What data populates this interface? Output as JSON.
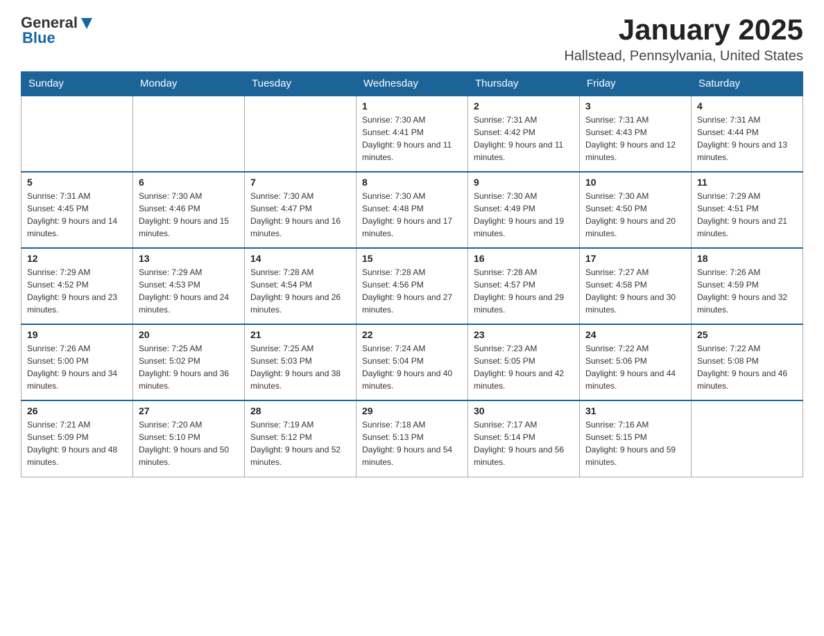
{
  "header": {
    "logo": {
      "general": "General",
      "blue": "Blue"
    },
    "title": "January 2025",
    "location": "Hallstead, Pennsylvania, United States"
  },
  "days_of_week": [
    "Sunday",
    "Monday",
    "Tuesday",
    "Wednesday",
    "Thursday",
    "Friday",
    "Saturday"
  ],
  "weeks": [
    [
      {
        "day": "",
        "sunrise": "",
        "sunset": "",
        "daylight": ""
      },
      {
        "day": "",
        "sunrise": "",
        "sunset": "",
        "daylight": ""
      },
      {
        "day": "",
        "sunrise": "",
        "sunset": "",
        "daylight": ""
      },
      {
        "day": "1",
        "sunrise": "Sunrise: 7:30 AM",
        "sunset": "Sunset: 4:41 PM",
        "daylight": "Daylight: 9 hours and 11 minutes."
      },
      {
        "day": "2",
        "sunrise": "Sunrise: 7:31 AM",
        "sunset": "Sunset: 4:42 PM",
        "daylight": "Daylight: 9 hours and 11 minutes."
      },
      {
        "day": "3",
        "sunrise": "Sunrise: 7:31 AM",
        "sunset": "Sunset: 4:43 PM",
        "daylight": "Daylight: 9 hours and 12 minutes."
      },
      {
        "day": "4",
        "sunrise": "Sunrise: 7:31 AM",
        "sunset": "Sunset: 4:44 PM",
        "daylight": "Daylight: 9 hours and 13 minutes."
      }
    ],
    [
      {
        "day": "5",
        "sunrise": "Sunrise: 7:31 AM",
        "sunset": "Sunset: 4:45 PM",
        "daylight": "Daylight: 9 hours and 14 minutes."
      },
      {
        "day": "6",
        "sunrise": "Sunrise: 7:30 AM",
        "sunset": "Sunset: 4:46 PM",
        "daylight": "Daylight: 9 hours and 15 minutes."
      },
      {
        "day": "7",
        "sunrise": "Sunrise: 7:30 AM",
        "sunset": "Sunset: 4:47 PM",
        "daylight": "Daylight: 9 hours and 16 minutes."
      },
      {
        "day": "8",
        "sunrise": "Sunrise: 7:30 AM",
        "sunset": "Sunset: 4:48 PM",
        "daylight": "Daylight: 9 hours and 17 minutes."
      },
      {
        "day": "9",
        "sunrise": "Sunrise: 7:30 AM",
        "sunset": "Sunset: 4:49 PM",
        "daylight": "Daylight: 9 hours and 19 minutes."
      },
      {
        "day": "10",
        "sunrise": "Sunrise: 7:30 AM",
        "sunset": "Sunset: 4:50 PM",
        "daylight": "Daylight: 9 hours and 20 minutes."
      },
      {
        "day": "11",
        "sunrise": "Sunrise: 7:29 AM",
        "sunset": "Sunset: 4:51 PM",
        "daylight": "Daylight: 9 hours and 21 minutes."
      }
    ],
    [
      {
        "day": "12",
        "sunrise": "Sunrise: 7:29 AM",
        "sunset": "Sunset: 4:52 PM",
        "daylight": "Daylight: 9 hours and 23 minutes."
      },
      {
        "day": "13",
        "sunrise": "Sunrise: 7:29 AM",
        "sunset": "Sunset: 4:53 PM",
        "daylight": "Daylight: 9 hours and 24 minutes."
      },
      {
        "day": "14",
        "sunrise": "Sunrise: 7:28 AM",
        "sunset": "Sunset: 4:54 PM",
        "daylight": "Daylight: 9 hours and 26 minutes."
      },
      {
        "day": "15",
        "sunrise": "Sunrise: 7:28 AM",
        "sunset": "Sunset: 4:56 PM",
        "daylight": "Daylight: 9 hours and 27 minutes."
      },
      {
        "day": "16",
        "sunrise": "Sunrise: 7:28 AM",
        "sunset": "Sunset: 4:57 PM",
        "daylight": "Daylight: 9 hours and 29 minutes."
      },
      {
        "day": "17",
        "sunrise": "Sunrise: 7:27 AM",
        "sunset": "Sunset: 4:58 PM",
        "daylight": "Daylight: 9 hours and 30 minutes."
      },
      {
        "day": "18",
        "sunrise": "Sunrise: 7:26 AM",
        "sunset": "Sunset: 4:59 PM",
        "daylight": "Daylight: 9 hours and 32 minutes."
      }
    ],
    [
      {
        "day": "19",
        "sunrise": "Sunrise: 7:26 AM",
        "sunset": "Sunset: 5:00 PM",
        "daylight": "Daylight: 9 hours and 34 minutes."
      },
      {
        "day": "20",
        "sunrise": "Sunrise: 7:25 AM",
        "sunset": "Sunset: 5:02 PM",
        "daylight": "Daylight: 9 hours and 36 minutes."
      },
      {
        "day": "21",
        "sunrise": "Sunrise: 7:25 AM",
        "sunset": "Sunset: 5:03 PM",
        "daylight": "Daylight: 9 hours and 38 minutes."
      },
      {
        "day": "22",
        "sunrise": "Sunrise: 7:24 AM",
        "sunset": "Sunset: 5:04 PM",
        "daylight": "Daylight: 9 hours and 40 minutes."
      },
      {
        "day": "23",
        "sunrise": "Sunrise: 7:23 AM",
        "sunset": "Sunset: 5:05 PM",
        "daylight": "Daylight: 9 hours and 42 minutes."
      },
      {
        "day": "24",
        "sunrise": "Sunrise: 7:22 AM",
        "sunset": "Sunset: 5:06 PM",
        "daylight": "Daylight: 9 hours and 44 minutes."
      },
      {
        "day": "25",
        "sunrise": "Sunrise: 7:22 AM",
        "sunset": "Sunset: 5:08 PM",
        "daylight": "Daylight: 9 hours and 46 minutes."
      }
    ],
    [
      {
        "day": "26",
        "sunrise": "Sunrise: 7:21 AM",
        "sunset": "Sunset: 5:09 PM",
        "daylight": "Daylight: 9 hours and 48 minutes."
      },
      {
        "day": "27",
        "sunrise": "Sunrise: 7:20 AM",
        "sunset": "Sunset: 5:10 PM",
        "daylight": "Daylight: 9 hours and 50 minutes."
      },
      {
        "day": "28",
        "sunrise": "Sunrise: 7:19 AM",
        "sunset": "Sunset: 5:12 PM",
        "daylight": "Daylight: 9 hours and 52 minutes."
      },
      {
        "day": "29",
        "sunrise": "Sunrise: 7:18 AM",
        "sunset": "Sunset: 5:13 PM",
        "daylight": "Daylight: 9 hours and 54 minutes."
      },
      {
        "day": "30",
        "sunrise": "Sunrise: 7:17 AM",
        "sunset": "Sunset: 5:14 PM",
        "daylight": "Daylight: 9 hours and 56 minutes."
      },
      {
        "day": "31",
        "sunrise": "Sunrise: 7:16 AM",
        "sunset": "Sunset: 5:15 PM",
        "daylight": "Daylight: 9 hours and 59 minutes."
      },
      {
        "day": "",
        "sunrise": "",
        "sunset": "",
        "daylight": ""
      }
    ]
  ]
}
